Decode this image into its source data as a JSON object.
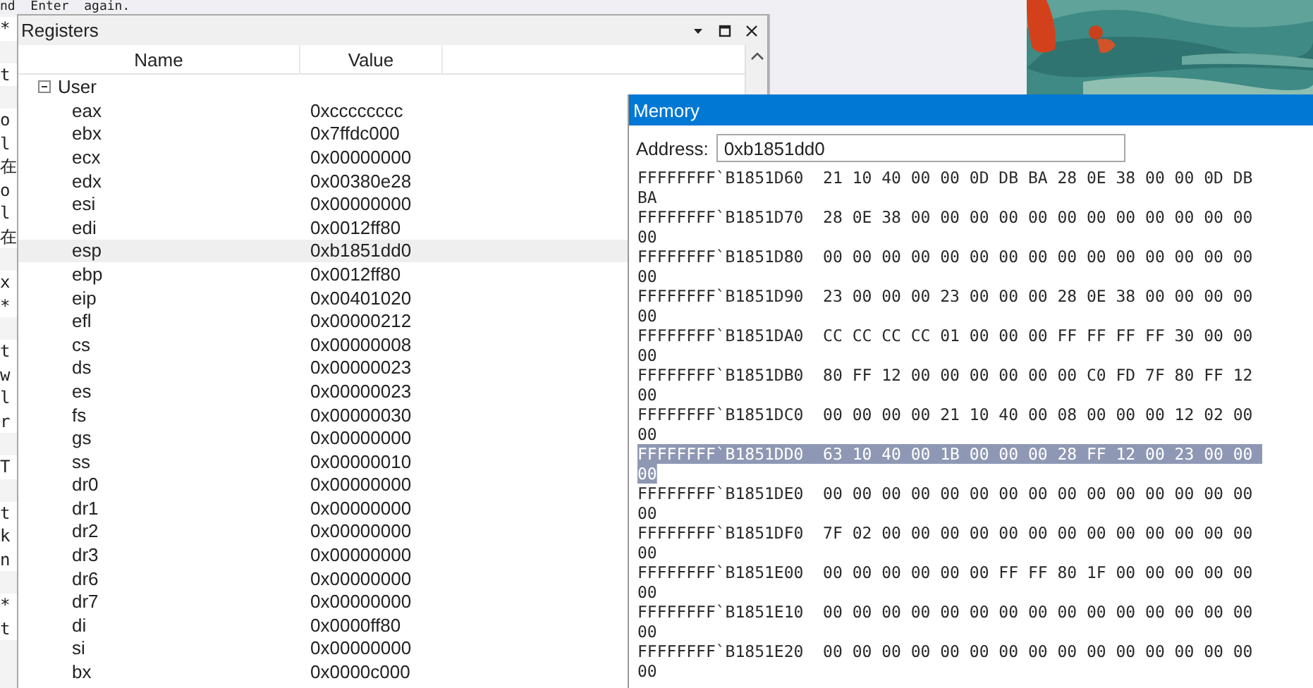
{
  "editor": {
    "top_line": "nd  Enter  again.",
    "code_blocks": [
      [
        "*"
      ],
      [
        "t"
      ],
      [
        "o",
        "l",
        "在",
        "o",
        "l",
        "在"
      ],
      [
        "x",
        "*"
      ],
      [
        "t",
        "w",
        "l",
        "r"
      ],
      [
        "T"
      ],
      [
        "t",
        "k",
        "n"
      ],
      [
        "*",
        "t"
      ]
    ]
  },
  "registers": {
    "title": "Registers",
    "columns": [
      "Name",
      "Value"
    ],
    "groups": [
      {
        "name": "User",
        "expanded": true,
        "children": [
          {
            "name": "eax",
            "value": "0xcccccccc",
            "selected": false
          },
          {
            "name": "ebx",
            "value": "0x7ffdc000",
            "selected": false
          },
          {
            "name": "ecx",
            "value": "0x00000000",
            "selected": false
          },
          {
            "name": "edx",
            "value": "0x00380e28",
            "selected": false
          },
          {
            "name": "esi",
            "value": "0x00000000",
            "selected": false
          },
          {
            "name": "edi",
            "value": "0x0012ff80",
            "selected": false
          },
          {
            "name": "esp",
            "value": "0xb1851dd0",
            "selected": true
          },
          {
            "name": "ebp",
            "value": "0x0012ff80",
            "selected": false
          },
          {
            "name": "eip",
            "value": "0x00401020",
            "selected": false
          },
          {
            "name": "efl",
            "value": "0x00000212",
            "selected": false
          },
          {
            "name": "cs",
            "value": "0x00000008",
            "selected": false
          },
          {
            "name": "ds",
            "value": "0x00000023",
            "selected": false
          },
          {
            "name": "es",
            "value": "0x00000023",
            "selected": false
          },
          {
            "name": "fs",
            "value": "0x00000030",
            "selected": false
          },
          {
            "name": "gs",
            "value": "0x00000000",
            "selected": false
          },
          {
            "name": "ss",
            "value": "0x00000010",
            "selected": false
          },
          {
            "name": "dr0",
            "value": "0x00000000",
            "selected": false
          },
          {
            "name": "dr1",
            "value": "0x00000000",
            "selected": false
          },
          {
            "name": "dr2",
            "value": "0x00000000",
            "selected": false
          },
          {
            "name": "dr3",
            "value": "0x00000000",
            "selected": false
          },
          {
            "name": "dr6",
            "value": "0x00000000",
            "selected": false
          },
          {
            "name": "dr7",
            "value": "0x00000000",
            "selected": false
          },
          {
            "name": "di",
            "value": "0x0000ff80",
            "selected": false
          },
          {
            "name": "si",
            "value": "0x00000000",
            "selected": false
          },
          {
            "name": "bx",
            "value": "0x0000c000",
            "selected": false
          }
        ]
      }
    ]
  },
  "memory": {
    "title": "Memory",
    "address_label": "Address:",
    "address_value": "0xb1851dd0",
    "rows": [
      {
        "address": "FFFFFFFF`B1851D60",
        "bytes": "21 10 40 00 00 0D DB BA 28 0E 38 00 00 0D DB BA",
        "selected": false
      },
      {
        "address": "FFFFFFFF`B1851D70",
        "bytes": "28 0E 38 00 00 00 00 00 00 00 00 00 00 00 00 00",
        "selected": false
      },
      {
        "address": "FFFFFFFF`B1851D80",
        "bytes": "00 00 00 00 00 00 00 00 00 00 00 00 00 00 00 00",
        "selected": false
      },
      {
        "address": "FFFFFFFF`B1851D90",
        "bytes": "23 00 00 00 23 00 00 00 28 0E 38 00 00 00 00 00",
        "selected": false
      },
      {
        "address": "FFFFFFFF`B1851DA0",
        "bytes": "CC CC CC CC 01 00 00 00 FF FF FF FF 30 00 00 00",
        "selected": false
      },
      {
        "address": "FFFFFFFF`B1851DB0",
        "bytes": "80 FF 12 00 00 00 00 00 00 C0 FD 7F 80 FF 12 00",
        "selected": false
      },
      {
        "address": "FFFFFFFF`B1851DC0",
        "bytes": "00 00 00 00 21 10 40 00 08 00 00 00 12 02 00 00",
        "selected": false
      },
      {
        "address": "FFFFFFFF`B1851DD0",
        "bytes": "63 10 40 00 1B 00 00 00 28 FF 12 00 23 00 00 00",
        "selected": true
      },
      {
        "address": "FFFFFFFF`B1851DE0",
        "bytes": "00 00 00 00 00 00 00 00 00 00 00 00 00 00 00 00",
        "selected": false
      },
      {
        "address": "FFFFFFFF`B1851DF0",
        "bytes": "7F 02 00 00 00 00 00 00 00 00 00 00 00 00 00 00",
        "selected": false
      },
      {
        "address": "FFFFFFFF`B1851E00",
        "bytes": "00 00 00 00 00 00 FF FF 80 1F 00 00 00 00 00 00",
        "selected": false
      },
      {
        "address": "FFFFFFFF`B1851E10",
        "bytes": "00 00 00 00 00 00 00 00 00 00 00 00 00 00 00 00",
        "selected": false
      },
      {
        "address": "FFFFFFFF`B1851E20",
        "bytes": "00 00 00 00 00 00 00 00 00 00 00 00 00 00 00 00",
        "selected": false
      }
    ]
  }
}
